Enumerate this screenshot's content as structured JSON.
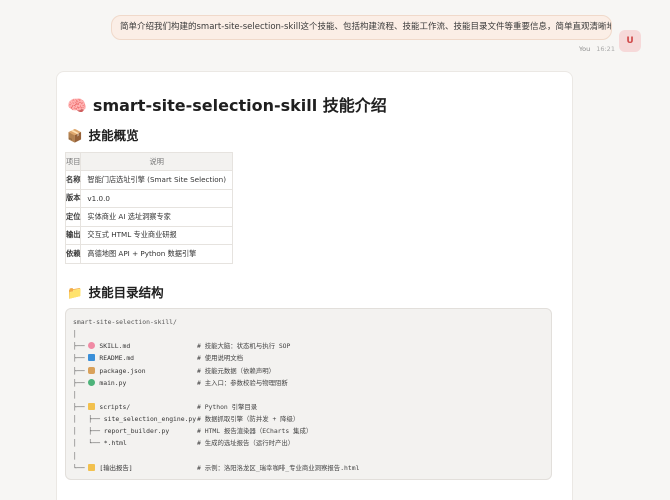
{
  "user_message": {
    "text": "简单介绍我们构建的smart-site-selection-skill这个技能、包括构建流程、技能工作流、技能目录文件等重要信息，简单直观清晰地呈现出来。",
    "author": "You",
    "time": "16:21",
    "avatar": "U"
  },
  "answer": {
    "title": "smart-site-selection-skill 技能介绍",
    "title_icon": "brain-emoji",
    "overview_heading": "技能概览",
    "overview_icon": "package-emoji",
    "table": {
      "headers": [
        "项目",
        "说明"
      ],
      "rows": [
        {
          "k": "名称",
          "v": "智能门店选址引擎 (Smart Site Selection)"
        },
        {
          "k": "版本",
          "v": "v1.0.0"
        },
        {
          "k": "定位",
          "v": "实体商业 AI 选址洞察专家"
        },
        {
          "k": "输出",
          "v": "交互式 HTML 专业商业研报"
        },
        {
          "k": "依赖",
          "v": "高德地图 API + Python 数据引擎"
        }
      ]
    },
    "structure_heading": "技能目录结构",
    "structure_icon": "folder-emoji",
    "tree": [
      {
        "prefix": "smart-site-selection-skill/",
        "icon": "",
        "name": "",
        "comment": ""
      },
      {
        "prefix": "│",
        "icon": "",
        "name": "",
        "comment": ""
      },
      {
        "prefix": "├── ",
        "icon": "brain",
        "name": "SKILL.md",
        "comment": "# 技能大脑：状态机与执行 SOP"
      },
      {
        "prefix": "├── ",
        "icon": "book",
        "name": "README.md",
        "comment": "# 使用说明文档"
      },
      {
        "prefix": "├── ",
        "icon": "box",
        "name": "package.json",
        "comment": "# 技能元数据（依赖声明）"
      },
      {
        "prefix": "├── ",
        "icon": "snake",
        "name": "main.py",
        "comment": "# 主入口：参数校验与物理阻断"
      },
      {
        "prefix": "│",
        "icon": "",
        "name": "",
        "comment": ""
      },
      {
        "prefix": "├── ",
        "icon": "folder",
        "name": "scripts/",
        "comment": "# Python 引擎目录"
      },
      {
        "prefix": "│   ├── ",
        "icon": "",
        "name": "site_selection_engine.py",
        "comment": "# 数据抓取引擎（防并发 + 降级）"
      },
      {
        "prefix": "│   ├── ",
        "icon": "",
        "name": "report_builder.py",
        "comment": "# HTML 报告渲染器（ECharts 集成）"
      },
      {
        "prefix": "│   └── ",
        "icon": "",
        "name": "*.html",
        "comment": "# 生成的选址报告（运行时产出）"
      },
      {
        "prefix": "│",
        "icon": "",
        "name": "",
        "comment": ""
      },
      {
        "prefix": "└── ",
        "icon": "folder",
        "name": "[输出报告]",
        "comment": "# 示例：洛阳洛龙区_瑞幸咖啡_专业商业洞察报告.html"
      }
    ]
  }
}
